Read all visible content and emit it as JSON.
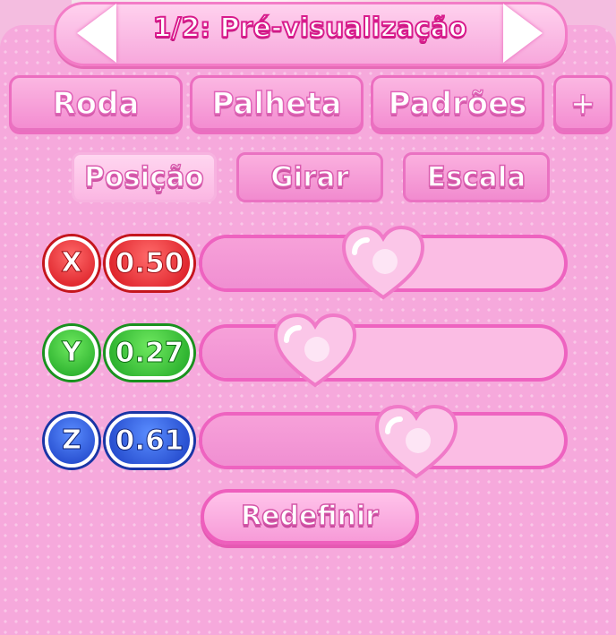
{
  "header": {
    "title": "1/2: Pré-visualização",
    "prev_icon": "arrow-left-icon",
    "next_icon": "arrow-right-icon"
  },
  "tabs": [
    {
      "label": "Roda"
    },
    {
      "label": "Palheta"
    },
    {
      "label": "Padrões"
    },
    {
      "label": "+"
    }
  ],
  "subtabs": [
    {
      "label": "Posição",
      "active": true
    },
    {
      "label": "Girar",
      "active": false
    },
    {
      "label": "Escala",
      "active": false
    }
  ],
  "sliders": [
    {
      "axis": "X",
      "value": "0.50",
      "fraction": 0.5,
      "color": "#d8161f"
    },
    {
      "axis": "Y",
      "value": "0.27",
      "fraction": 0.27,
      "color": "#1ea624"
    },
    {
      "axis": "Z",
      "value": "0.61",
      "fraction": 0.61,
      "color": "#1b3fc4"
    }
  ],
  "reset": {
    "label": "Redefinir"
  },
  "colors": {
    "panel": "#f6a9dc",
    "accent": "#ee63c0",
    "heart": "#fbc6e8"
  }
}
